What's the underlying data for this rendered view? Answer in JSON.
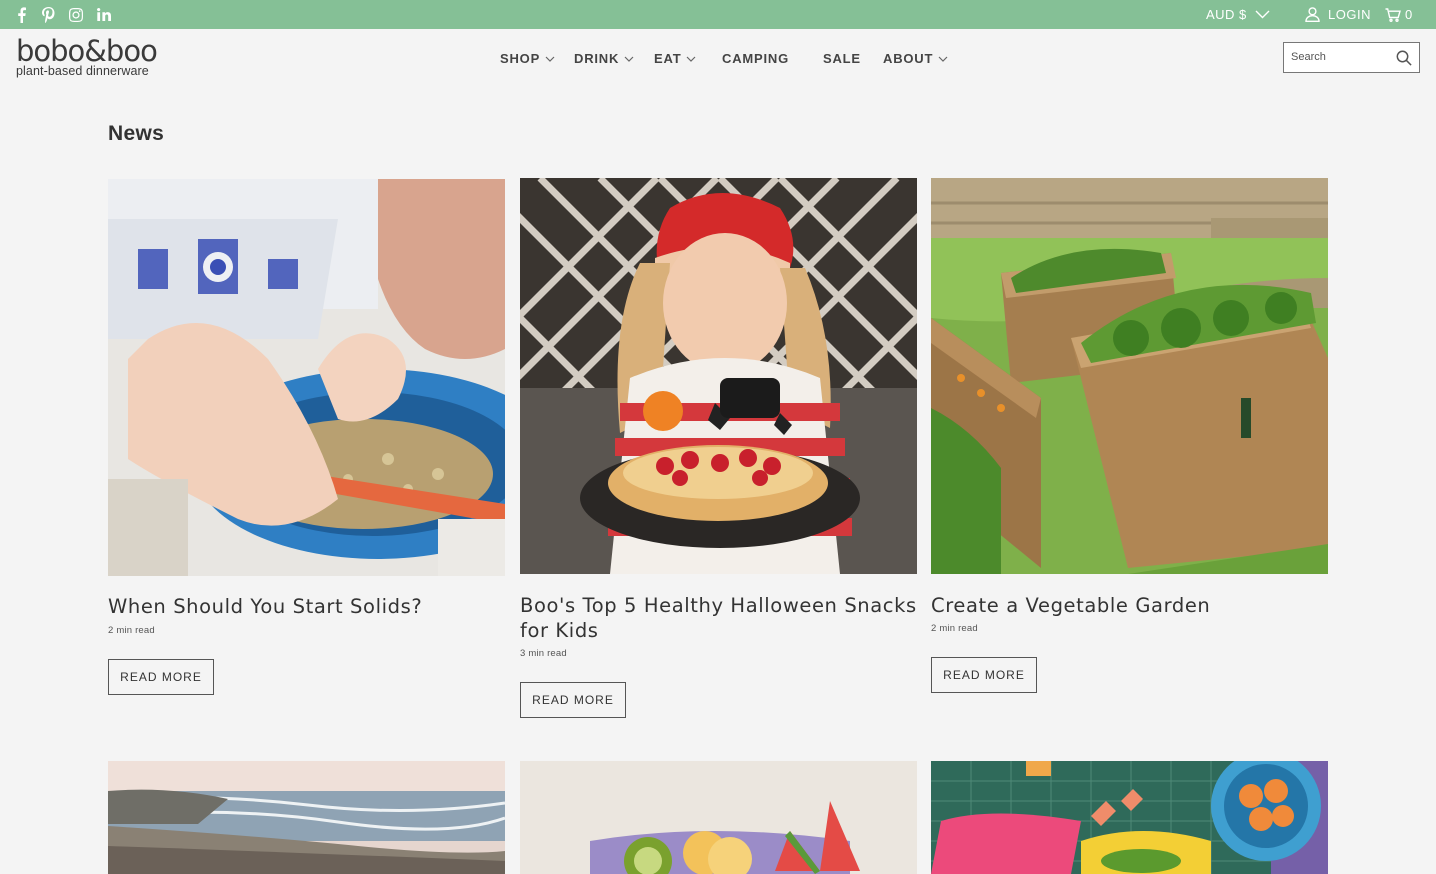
{
  "topbar": {
    "social": [
      "facebook-icon",
      "pinterest-icon",
      "instagram-icon",
      "linkedin-icon"
    ],
    "currency": "AUD $",
    "login": "LOGIN",
    "cart_count": "0"
  },
  "logo": {
    "brand": "bobo&boo",
    "tagline": "plant-based dinnerware"
  },
  "nav": [
    {
      "label": "SHOP"
    },
    {
      "label": "DRINK"
    },
    {
      "label": "EAT"
    },
    {
      "label": "CAMPING"
    },
    {
      "label": "SALE"
    },
    {
      "label": "ABOUT"
    }
  ],
  "search": {
    "placeholder": "Search"
  },
  "page": {
    "title": "News"
  },
  "articles": [
    {
      "title": "When Should You Start Solids?",
      "meta": "2 min read",
      "button": "READ MORE"
    },
    {
      "title": "Boo's Top 5 Healthy Halloween Snacks for Kids",
      "meta": "3 min read",
      "button": "READ MORE"
    },
    {
      "title": "Create a Vegetable Garden",
      "meta": "2 min read",
      "button": "READ MORE"
    }
  ],
  "colors": {
    "topbar": "#85c096",
    "background": "#f4f4f4",
    "text": "#333333"
  }
}
